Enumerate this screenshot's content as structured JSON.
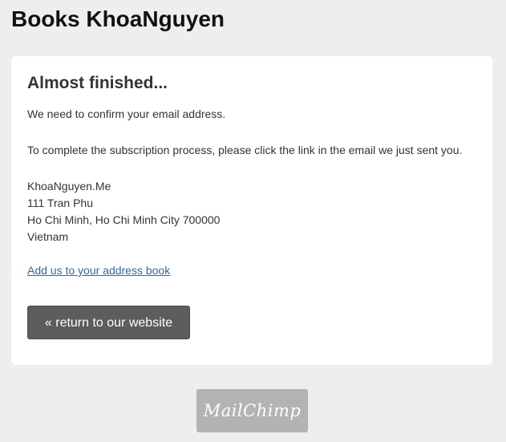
{
  "header": {
    "title": "Books KhoaNguyen"
  },
  "card": {
    "heading": "Almost finished...",
    "confirm_text": "We need to confirm your email address.",
    "complete_text": "To complete the subscription process, please click the link in the email we just sent you.",
    "address": {
      "name": "KhoaNguyen.Me",
      "street": "111 Tran Phu",
      "city": "Ho Chi Minh, Ho Chi Minh City 700000",
      "country": "Vietnam"
    },
    "address_book_link": "Add us to your address book",
    "return_button": "« return to our website"
  },
  "footer": {
    "logo_text": "MailChimp"
  },
  "colors": {
    "background": "#eeeeee",
    "card": "#ffffff",
    "link": "#336699",
    "button": "#5d5d5d",
    "logo_badge": "#b3b3b3"
  }
}
